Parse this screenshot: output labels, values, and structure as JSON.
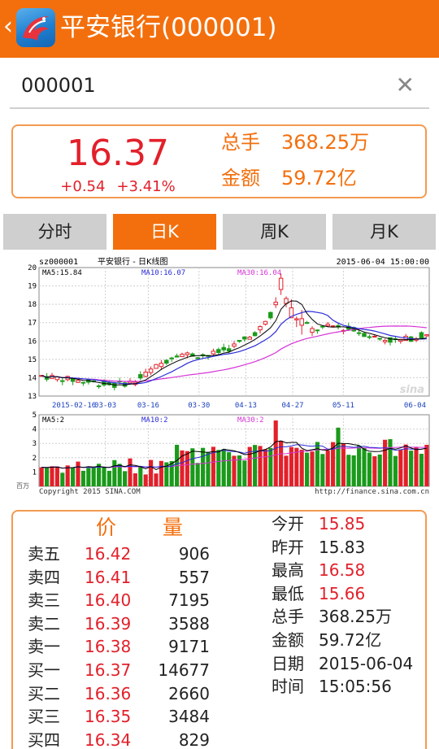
{
  "header": {
    "back_icon": "chevron-left-icon",
    "title": "平安银行(000001)"
  },
  "search": {
    "value": "000001",
    "clear_icon": "close-icon"
  },
  "quote": {
    "price": "16.37",
    "change": "+0.54",
    "change_pct": "+3.41%",
    "volume_label": "总手",
    "volume": "368.25万",
    "amount_label": "金额",
    "amount": "59.72亿"
  },
  "tabs": [
    "分时",
    "日K",
    "周K",
    "月K"
  ],
  "active_tab": "日K",
  "chart": {
    "code": "sz000001",
    "title": "平安银行 - 日K线图",
    "datetime": "2015-06-04 15:00:00",
    "ma5": "MA5:15.84",
    "ma10": "MA10:16.07",
    "ma30": "MA30:16.04",
    "y_ticks": [
      "20",
      "19",
      "18",
      "17",
      "16",
      "15",
      "14",
      "13"
    ],
    "x_ticks": [
      "2015-02-16",
      "03-03",
      "03-16",
      "03-30",
      "04-13",
      "04-27",
      "05-11",
      "06-04"
    ],
    "watermark": "sina",
    "vol_ma5": "MA5:2",
    "vol_ma10": "MA10:2",
    "vol_ma30": "MA30:2",
    "vol_y_ticks": [
      "5",
      "4",
      "3",
      "2",
      "1"
    ],
    "vol_unit": "百万",
    "copyright": "Copyright 2015 SINA.COM",
    "url": "http://finance.sina.com.cn"
  },
  "chart_data": {
    "type": "candlestick",
    "title": "平安银行 - 日K线图",
    "ylim": [
      13,
      20
    ],
    "vol_ylim": [
      0,
      5
    ],
    "x_start": "2015-02-16",
    "x_end": "2015-06-04",
    "ma_last": {
      "MA5": 15.84,
      "MA10": 16.07,
      "MA30": 16.04
    }
  },
  "orderbook": {
    "price_header": "价",
    "volume_header": "量",
    "rows": [
      {
        "label": "卖五",
        "price": "16.42",
        "volume": "906"
      },
      {
        "label": "卖四",
        "price": "16.41",
        "volume": "557"
      },
      {
        "label": "卖三",
        "price": "16.40",
        "volume": "7195"
      },
      {
        "label": "卖二",
        "price": "16.39",
        "volume": "3588"
      },
      {
        "label": "卖一",
        "price": "16.38",
        "volume": "9171"
      },
      {
        "label": "买一",
        "price": "16.37",
        "volume": "14677"
      },
      {
        "label": "买二",
        "price": "16.36",
        "volume": "2660"
      },
      {
        "label": "买三",
        "price": "16.35",
        "volume": "3484"
      },
      {
        "label": "买四",
        "price": "16.34",
        "volume": "829"
      }
    ]
  },
  "info": [
    {
      "label": "今开",
      "value": "15.85",
      "red": true
    },
    {
      "label": "昨开",
      "value": "15.83",
      "red": false
    },
    {
      "label": "最高",
      "value": "16.58",
      "red": true
    },
    {
      "label": "最低",
      "value": "15.66",
      "red": true
    },
    {
      "label": "总手",
      "value": "368.25万",
      "red": false
    },
    {
      "label": "金额",
      "value": "59.72亿",
      "red": false
    },
    {
      "label": "日期",
      "value": "2015-06-04",
      "red": false
    },
    {
      "label": "时间",
      "value": "15:05:56",
      "red": false
    }
  ],
  "colors": {
    "accent": "#f36f0d",
    "up": "#e2202a",
    "down": "#1a9a1a",
    "ma5": "#000000",
    "ma10": "#2b2bd9",
    "ma30": "#d633d6"
  }
}
